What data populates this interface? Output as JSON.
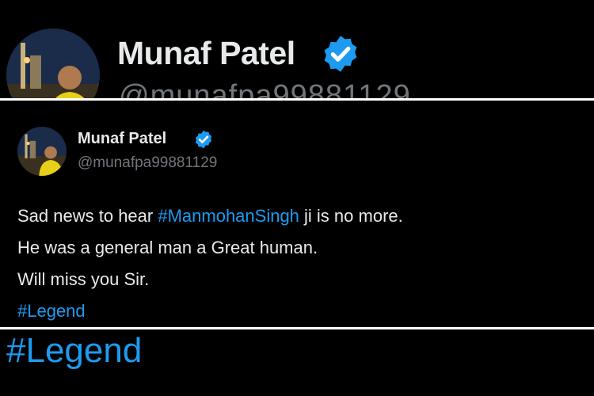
{
  "profile": {
    "display_name": "Munaf Patel",
    "handle": "@munafpa99881129",
    "verified_icon": "verified-badge-icon",
    "avatar_icon": "profile-photo-avatar"
  },
  "zoom_top": {
    "display_name": "Munaf Patel",
    "handle_partial": "@munafpa99881129"
  },
  "tweet": {
    "line1_prefix": "Sad news to hear ",
    "line1_hashtag": "#ManmohanSingh",
    "line1_suffix": " ji is no more.",
    "line2": "He was a general man a Great human.",
    "line3": "Will miss you Sir.",
    "line4_hashtag": "#Legend"
  },
  "zoom_bottom": {
    "hashtag": "#Legend"
  },
  "colors": {
    "background": "#000000",
    "text": "#e7e9ea",
    "muted": "#71767b",
    "link": "#1d9bf0",
    "verified": "#1d9bf0"
  }
}
